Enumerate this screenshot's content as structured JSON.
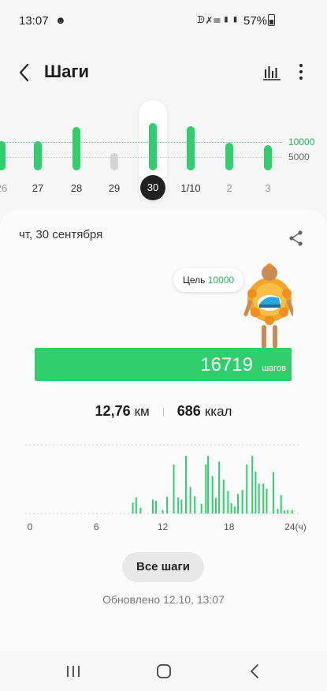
{
  "status_bar": {
    "time": "13:07",
    "battery": "57%",
    "icons": [
      "person-icon",
      "bluetooth-icon",
      "mute-icon",
      "wifi-icon",
      "signal-icon",
      "signal-icon",
      "battery-icon"
    ]
  },
  "header": {
    "title": "Шаги",
    "icons": [
      "back-icon",
      "trends-icon",
      "more-icon"
    ]
  },
  "week_chart": {
    "goal_10000_label": "10000",
    "goal_5000_label": "5000",
    "days": [
      {
        "label": "26",
        "steps": 10300,
        "muted": false,
        "selected": false,
        "future": true
      },
      {
        "label": "27",
        "steps": 10400,
        "muted": false,
        "selected": false,
        "future": false
      },
      {
        "label": "28",
        "steps": 15200,
        "muted": false,
        "selected": false,
        "future": false
      },
      {
        "label": "29",
        "steps": 6000,
        "muted": true,
        "selected": false,
        "future": false
      },
      {
        "label": "30",
        "steps": 16719,
        "muted": false,
        "selected": true,
        "future": false
      },
      {
        "label": "1/10",
        "steps": 15500,
        "muted": false,
        "selected": false,
        "future": false
      },
      {
        "label": "2",
        "steps": 9600,
        "muted": false,
        "selected": false,
        "future": true
      },
      {
        "label": "3",
        "steps": 8800,
        "muted": false,
        "selected": false,
        "future": true
      }
    ],
    "max_steps": 17000,
    "colors": {
      "bar": "#2fcf6e",
      "muted_bar": "#d4d4d4",
      "goal_line": "#5ecf8b"
    }
  },
  "card": {
    "date": "чт, 30 сентября",
    "goal_label": "Цель",
    "goal_value": "10000",
    "steps_value": "16719",
    "steps_unit": "шагов",
    "steps_fraction_of_bar": 1.0,
    "distance_value": "12,76",
    "distance_unit": "км",
    "calories_value": "686",
    "calories_unit": "ккал",
    "all_steps_button": "Все шаги",
    "updated_text": "Обновлено 12.10, 13:07"
  },
  "chart_data": {
    "type": "bar",
    "title": "",
    "xlabel": "",
    "ylabel": "",
    "x_ticks": [
      "0",
      "6",
      "12",
      "18",
      "24(ч)"
    ],
    "xlim": [
      0,
      24
    ],
    "ylim": [
      0,
      1000
    ],
    "grid": true,
    "x": [
      9.3,
      9.6,
      10.0,
      11.1,
      11.4,
      12.0,
      12.4,
      13.0,
      13.4,
      13.7,
      14.1,
      14.5,
      14.9,
      15.5,
      15.9,
      16.1,
      16.5,
      16.8,
      17.1,
      17.5,
      17.9,
      18.2,
      18.5,
      18.8,
      19.2,
      19.6,
      20.1,
      20.4,
      20.7,
      21.1,
      21.4,
      22.0,
      22.4,
      22.7,
      23.0,
      23.3,
      23.7
    ],
    "values": [
      190,
      280,
      100,
      240,
      220,
      60,
      290,
      850,
      280,
      240,
      1000,
      460,
      300,
      170,
      850,
      1000,
      650,
      270,
      900,
      590,
      390,
      180,
      120,
      340,
      410,
      850,
      1000,
      730,
      520,
      520,
      430,
      720,
      80,
      320,
      50,
      60,
      60
    ],
    "color": "#2fcf6e"
  },
  "nav": {
    "buttons": [
      "recent-apps-icon",
      "home-icon",
      "back-nav-icon"
    ]
  }
}
